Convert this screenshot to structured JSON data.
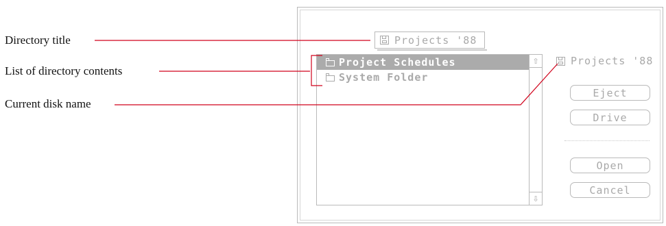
{
  "callouts": {
    "directory_title": "Directory title",
    "list_contents": "List of directory contents",
    "disk_name": "Current disk name"
  },
  "dialog": {
    "directory_popup": {
      "icon": "disk-icon",
      "label": "Projects '88"
    },
    "file_list": {
      "items": [
        {
          "icon": "folder-icon",
          "label": "Project Schedules",
          "selected": true
        },
        {
          "icon": "folder-icon",
          "label": "System Folder",
          "selected": false
        }
      ],
      "scroll_up_icon": "⇧",
      "scroll_down_icon": "⇩"
    },
    "disk": {
      "icon": "disk-icon",
      "label": "Projects '88"
    },
    "buttons": {
      "eject": "Eject",
      "drive": "Drive",
      "open": "Open",
      "cancel": "Cancel"
    }
  },
  "colors": {
    "leader_line": "#d0021b",
    "dimmed_text": "#a9a9a9",
    "selection": "#ababab"
  }
}
